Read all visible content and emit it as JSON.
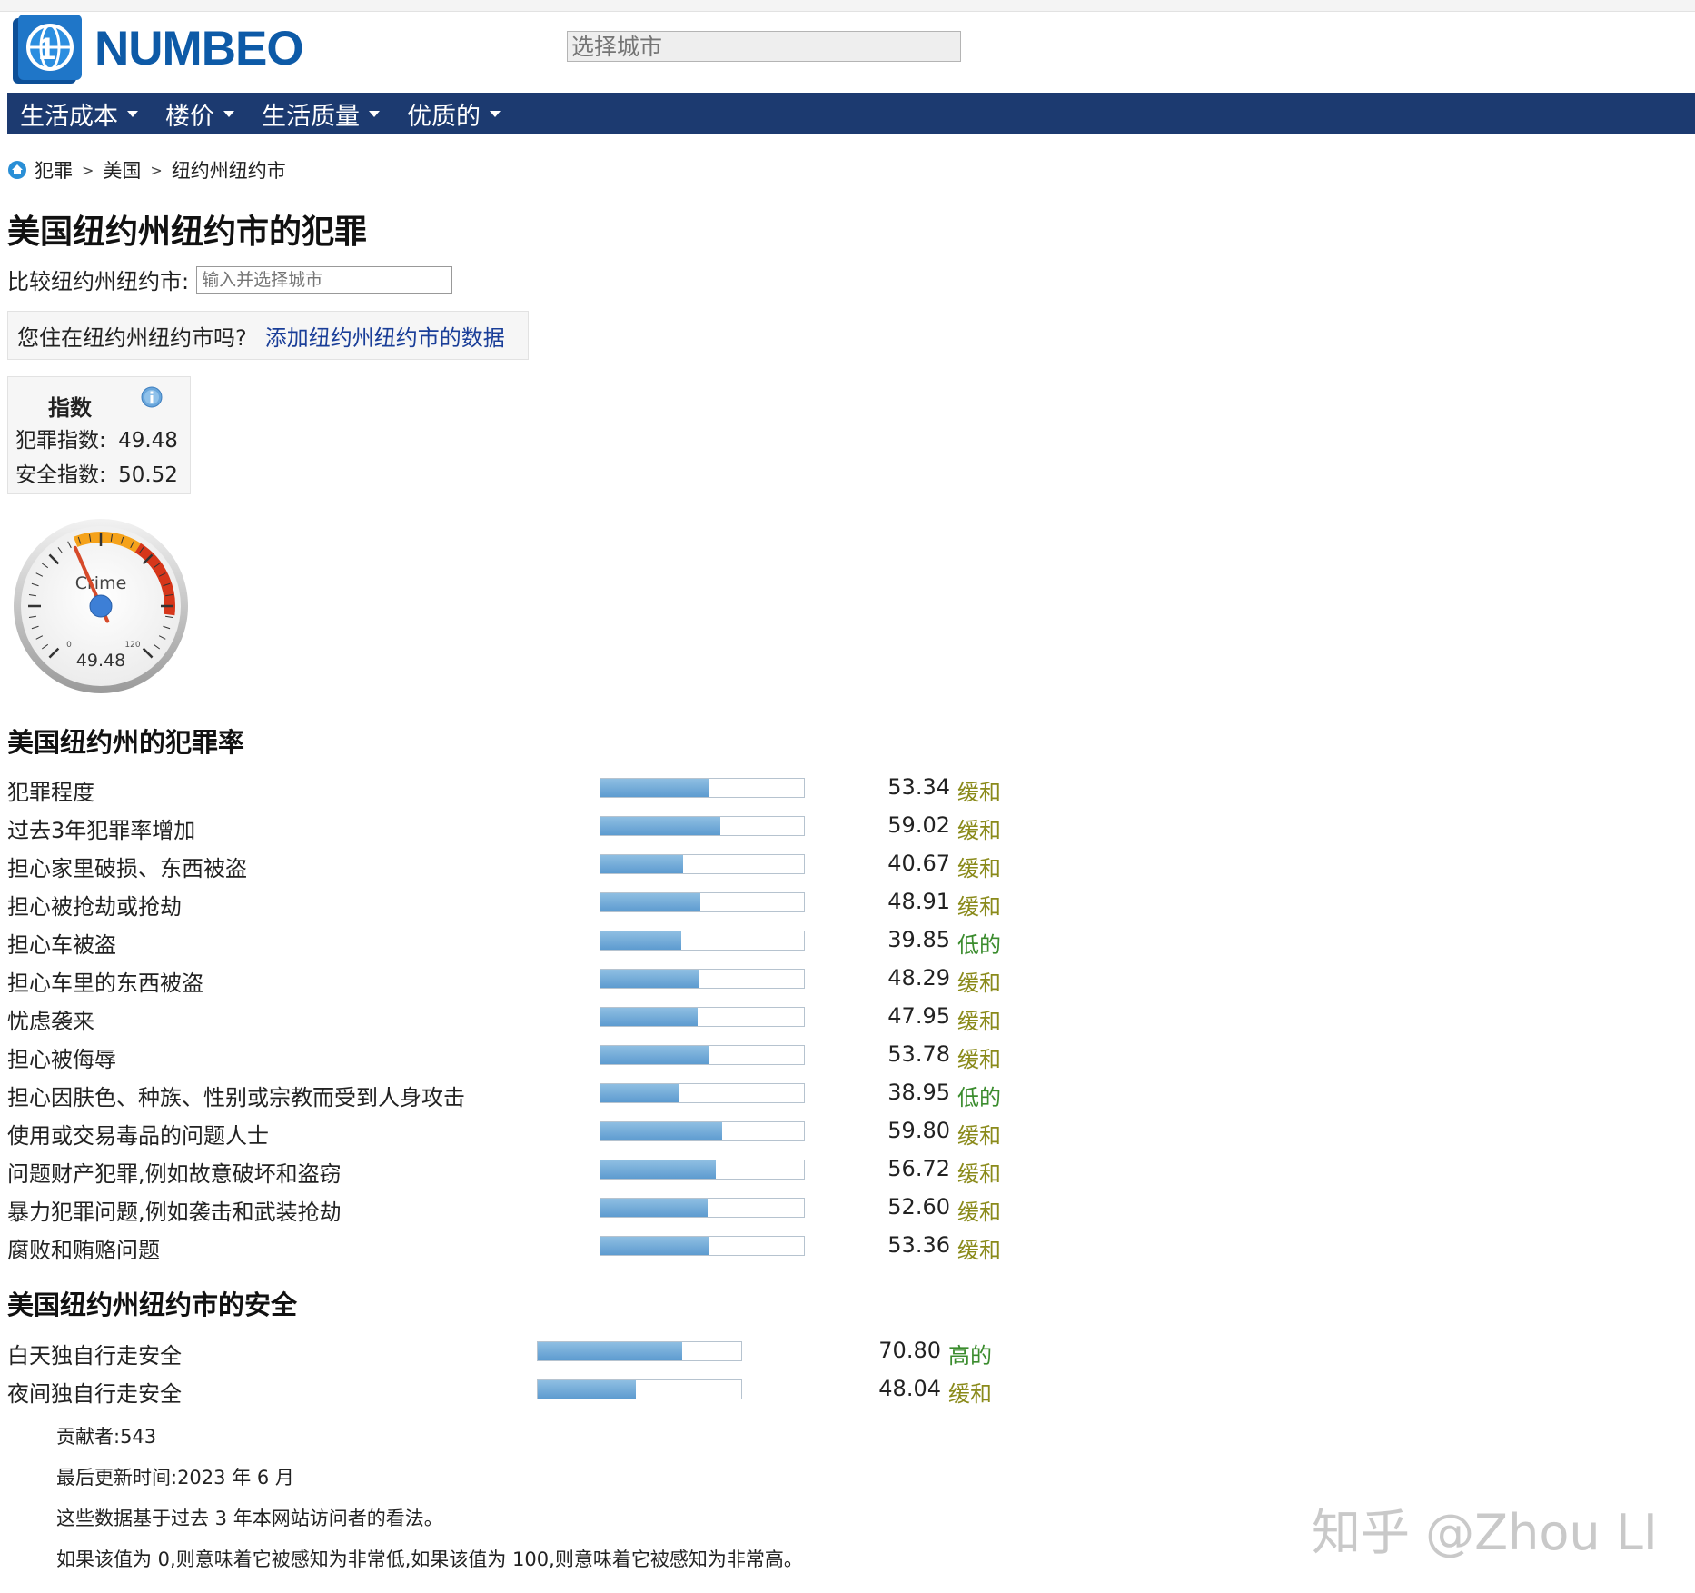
{
  "logo": {
    "text": "NUMBEO"
  },
  "header": {
    "city_search_placeholder": "选择城市"
  },
  "nav": [
    {
      "label": "生活成本"
    },
    {
      "label": "楼价"
    },
    {
      "label": "生活质量"
    },
    {
      "label": "优质的"
    }
  ],
  "breadcrumb": {
    "items": [
      "犯罪",
      "美国",
      "纽约州纽约市"
    ],
    "separator": ">"
  },
  "title": "美国纽约州纽约市的犯罪",
  "compare": {
    "label": "比较纽约州纽约市:",
    "placeholder": "输入并选择城市"
  },
  "resident": {
    "question": "您住在纽约州纽约市吗?",
    "link": "添加纽约州纽约市的数据"
  },
  "index": {
    "heading": "指数",
    "crime_label": "犯罪指数:",
    "crime_value": "49.48",
    "safety_label": "安全指数:",
    "safety_value": "50.52"
  },
  "gauge": {
    "label": "Crime",
    "value": "49.48",
    "min_label": "0",
    "max_label": "120",
    "value_num": 49.48,
    "max": 120
  },
  "crime_section": {
    "title": "美国纽约州的犯罪率",
    "rows": [
      {
        "label": "犯罪程度",
        "value": "53.34",
        "level": "缓和",
        "level_type": "moderate"
      },
      {
        "label": "过去3年犯罪率增加",
        "value": "59.02",
        "level": "缓和",
        "level_type": "moderate"
      },
      {
        "label": "担心家里破损、东西被盗",
        "value": "40.67",
        "level": "缓和",
        "level_type": "moderate"
      },
      {
        "label": "担心被抢劫或抢劫",
        "value": "48.91",
        "level": "缓和",
        "level_type": "moderate"
      },
      {
        "label": "担心车被盗",
        "value": "39.85",
        "level": "低的",
        "level_type": "low"
      },
      {
        "label": "担心车里的东西被盗",
        "value": "48.29",
        "level": "缓和",
        "level_type": "moderate"
      },
      {
        "label": "忧虑袭来",
        "value": "47.95",
        "level": "缓和",
        "level_type": "moderate"
      },
      {
        "label": "担心被侮辱",
        "value": "53.78",
        "level": "缓和",
        "level_type": "moderate"
      },
      {
        "label": "担心因肤色、种族、性别或宗教而受到人身攻击",
        "value": "38.95",
        "level": "低的",
        "level_type": "low"
      },
      {
        "label": "使用或交易毒品的问题人士",
        "value": "59.80",
        "level": "缓和",
        "level_type": "moderate"
      },
      {
        "label": "问题财产犯罪,例如故意破坏和盗窃",
        "value": "56.72",
        "level": "缓和",
        "level_type": "moderate"
      },
      {
        "label": "暴力犯罪问题,例如袭击和武装抢劫",
        "value": "52.60",
        "level": "缓和",
        "level_type": "moderate"
      },
      {
        "label": "腐败和贿赂问题",
        "value": "53.36",
        "level": "缓和",
        "level_type": "moderate"
      }
    ]
  },
  "safety_section": {
    "title": "美国纽约州纽约市的安全",
    "rows": [
      {
        "label": "白天独自行走安全",
        "value": "70.80",
        "level": "高的",
        "level_type": "high"
      },
      {
        "label": "夜间独自行走安全",
        "value": "48.04",
        "level": "缓和",
        "level_type": "moderate"
      }
    ]
  },
  "notes": {
    "contributors": "贡献者:543",
    "updated": "最后更新时间:2023 年 6 月",
    "basis": "这些数据基于过去 3 年本网站访问者的看法。",
    "scale": "如果该值为 0,则意味着它被感知为非常低,如果该值为 100,则意味着它被感知为非常高。"
  },
  "watermark": "知乎 @Zhou LI",
  "colors": {
    "nav_bg": "#1c3a70",
    "logo_blue": "#0d5aa7",
    "bar_fill": "#5d9bd0",
    "moderate": "#8a8a1a",
    "low_high": "#3b8c2e"
  },
  "icons": {
    "home": "home-icon",
    "info": "info-icon"
  }
}
